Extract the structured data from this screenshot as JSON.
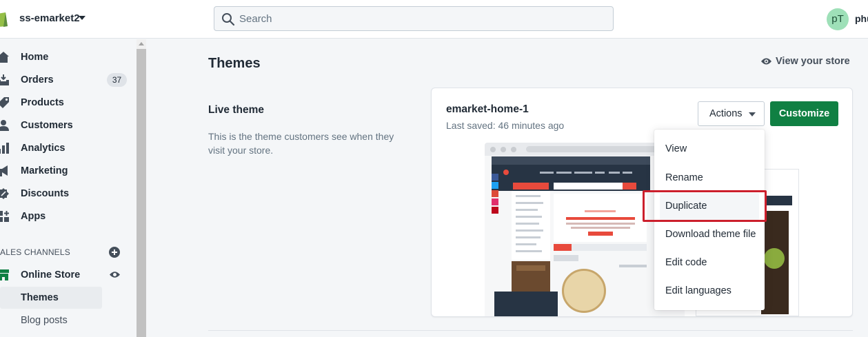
{
  "topbar": {
    "store_name": "ss-emarket2",
    "search_placeholder": "Search",
    "avatar_initials": "pT",
    "user_name": "phu"
  },
  "sidebar": {
    "items": [
      {
        "label": "Home",
        "icon": "home-icon"
      },
      {
        "label": "Orders",
        "icon": "orders-icon",
        "badge": "37"
      },
      {
        "label": "Products",
        "icon": "tag-icon"
      },
      {
        "label": "Customers",
        "icon": "person-icon"
      },
      {
        "label": "Analytics",
        "icon": "bar-chart-icon"
      },
      {
        "label": "Marketing",
        "icon": "megaphone-icon"
      },
      {
        "label": "Discounts",
        "icon": "discount-icon"
      },
      {
        "label": "Apps",
        "icon": "apps-icon"
      }
    ],
    "sales_channels_title": "ALES CHANNELS",
    "online_store_label": "Online Store",
    "sub_items": [
      {
        "label": "Themes",
        "active": true
      },
      {
        "label": "Blog posts",
        "active": false
      }
    ]
  },
  "main": {
    "page_title": "Themes",
    "view_store_label": "View your store",
    "live_theme_title": "Live theme",
    "live_theme_description": "This is the theme customers see when they visit your store.",
    "theme_card": {
      "name": "emarket-home-1",
      "last_saved": "Last saved: 46 minutes ago",
      "actions_label": "Actions",
      "customize_label": "Customize"
    },
    "actions_menu": [
      {
        "label": "View"
      },
      {
        "label": "Rename"
      },
      {
        "label": "Duplicate",
        "highlighted": true
      },
      {
        "label": "Download theme file"
      },
      {
        "label": "Edit code"
      },
      {
        "label": "Edit languages"
      }
    ]
  },
  "colors": {
    "primary_green": "#108043",
    "highlight_red": "#cc1f2c",
    "avatar_bg": "#9ee0b8"
  }
}
